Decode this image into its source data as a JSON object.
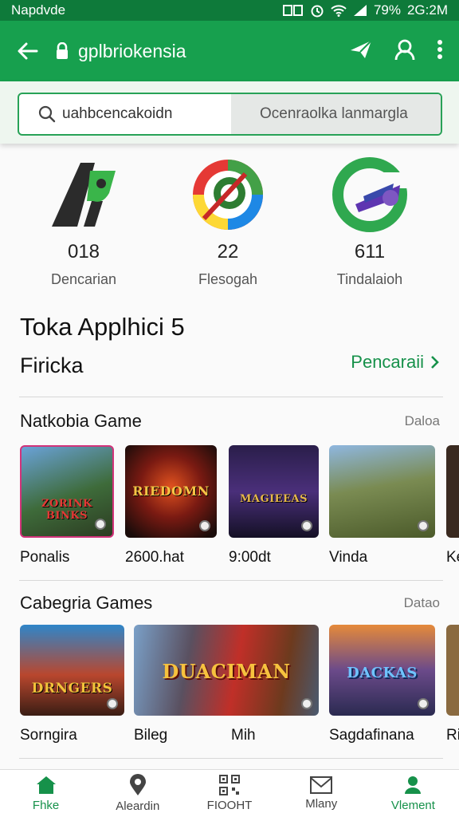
{
  "status": {
    "carrier": "Napdvde",
    "battery": "79%",
    "time": "2G:2M"
  },
  "appbar": {
    "url": "gplbriokensia"
  },
  "search": {
    "left_text": "uahbcencakoidn",
    "right_text": "Ocenraolka lanmargla"
  },
  "featured": [
    {
      "num": "018",
      "label": "Dencarian"
    },
    {
      "num": "22",
      "label": "Flesogah"
    },
    {
      "num": "611",
      "label": "Tindalaioh"
    }
  ],
  "headline": {
    "title": "Toka Applhici 5",
    "subtitle": "Firicka",
    "link": "Pencaraii"
  },
  "section1": {
    "title": "Natkobia Game",
    "more": "Daloa",
    "items": [
      {
        "name": "Ponalis",
        "art": "ZORINK BINKS"
      },
      {
        "name": "2600.hat",
        "art": "RIEDOMN"
      },
      {
        "name": "9:00dt",
        "art": "MAGIEEAS"
      },
      {
        "name": "Vinda",
        "art": ""
      },
      {
        "name": "Ke",
        "art": ""
      }
    ]
  },
  "section2": {
    "title": "Cabegria Games",
    "more": "Datao",
    "items": [
      {
        "name": "Sorngira",
        "art": "DRNGERS"
      },
      {
        "name": "Bileg",
        "art": ""
      },
      {
        "name": "Mih",
        "art": "DUACIMAN"
      },
      {
        "name": "Sagdafinana",
        "art": "DACKAS"
      },
      {
        "name": "Ri",
        "art": ""
      }
    ]
  },
  "bottomnav": [
    {
      "label": "Fhke",
      "icon": "home-icon"
    },
    {
      "label": "Aleardin",
      "icon": "location-pin-icon"
    },
    {
      "label": "FIOOHT",
      "icon": "qr-code-icon"
    },
    {
      "label": "Mlany",
      "icon": "mail-icon"
    },
    {
      "label": "Vlement",
      "icon": "profile-icon"
    }
  ],
  "colors": {
    "primary": "#17a04e",
    "status_bar": "#0e7a3a",
    "accent_text": "#16914a"
  }
}
